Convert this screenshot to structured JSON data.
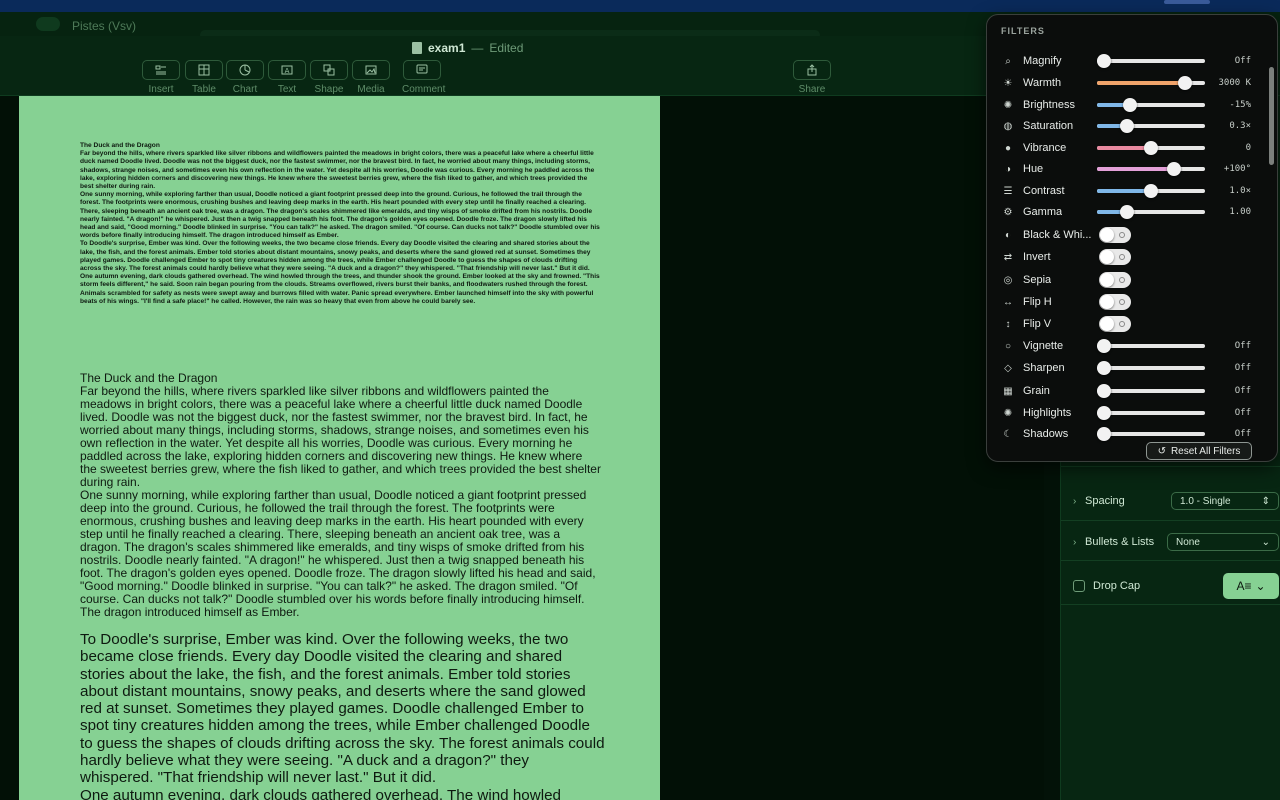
{
  "background_window": {
    "title": "Pistes (Vsv)"
  },
  "document": {
    "filename": "exam1",
    "status": "Edited"
  },
  "toolbar": {
    "insert": "Insert",
    "table": "Table",
    "chart": "Chart",
    "text": "Text",
    "shape": "Shape",
    "media": "Media",
    "comment": "Comment",
    "share": "Share"
  },
  "page": {
    "small_block": [
      "The Duck and the Dragon",
      "Far beyond the hills, where rivers sparkled like silver ribbons and wildflowers painted the meadows in bright colors, there was a peaceful lake where a cheerful little duck named Doodle lived. Doodle was not the biggest duck, nor the fastest swimmer, nor the bravest bird. In fact, he worried about many things, including storms, shadows, strange noises, and sometimes even his own reflection in the water. Yet despite all his worries, Doodle was curious. Every morning he paddled across the lake, exploring hidden corners and discovering new things. He knew where the sweetest berries grew, where the fish liked to gather, and which trees provided the best shelter during rain.",
      "One sunny morning, while exploring farther than usual, Doodle noticed a giant footprint pressed deep into the ground. Curious, he followed the trail through the forest. The footprints were enormous, crushing bushes and leaving deep marks in the earth. His heart pounded with every step until he finally reached a clearing. There, sleeping beneath an ancient oak tree, was a dragon. The dragon's scales shimmered like emeralds, and tiny wisps of smoke drifted from his nostrils. Doodle nearly fainted. \"A dragon!\" he whispered. Just then a twig snapped beneath his foot. The dragon's golden eyes opened. Doodle froze. The dragon slowly lifted his head and said, \"Good morning.\" Doodle blinked in surprise. \"You can talk?\" he asked. The dragon smiled. \"Of course. Can ducks not talk?\" Doodle stumbled over his words before finally introducing himself. The dragon introduced himself as Ember.",
      "To Doodle's surprise, Ember was kind. Over the following weeks, the two became close friends. Every day Doodle visited the clearing and shared stories about the lake, the fish, and the forest animals. Ember told stories about distant mountains, snowy peaks, and deserts where the sand glowed red at sunset. Sometimes they played games. Doodle challenged Ember to spot tiny creatures hidden among the trees, while Ember challenged Doodle to guess the shapes of clouds drifting across the sky. The forest animals could hardly believe what they were seeing. \"A duck and a dragon?\" they whispered. \"That friendship will never last.\" But it did.",
      "One autumn evening, dark clouds gathered overhead. The wind howled through the trees, and thunder shook the ground. Ember looked at the sky and frowned. \"This storm feels different,\" he said. Soon rain began pouring from the clouds. Streams overflowed, rivers burst their banks, and floodwaters rushed through the forest. Animals scrambled for safety as nests were swept away and burrows filled with water. Panic spread everywhere. Ember launched himself into the sky with powerful beats of his wings. \"I'll find a safe place!\" he called. However, the rain was so heavy that even from above he could barely see."
    ],
    "mid_block": [
      "The Duck and the Dragon",
      "Far beyond the hills, where rivers sparkled like silver ribbons and wildflowers painted the meadows in bright colors, there was a peaceful lake where a cheerful little duck named Doodle lived. Doodle was not the biggest duck, nor the fastest swimmer, nor the bravest bird. In fact, he worried about many things, including storms, shadows, strange noises, and sometimes even his own reflection in the water. Yet despite all his worries, Doodle was curious. Every morning he paddled across the lake, exploring hidden corners and discovering new things. He knew where the sweetest berries grew, where the fish liked to gather, and which trees provided the best shelter during rain.",
      "One sunny morning, while exploring farther than usual, Doodle noticed a giant footprint pressed deep into the ground. Curious, he followed the trail through the forest. The footprints were enormous, crushing bushes and leaving deep marks in the earth. His heart pounded with every step until he finally reached a clearing. There, sleeping beneath an ancient oak tree, was a dragon. The dragon's scales shimmered like emeralds, and tiny wisps of smoke drifted from his nostrils. Doodle nearly fainted. \"A dragon!\" he whispered. Just then a twig snapped beneath his foot. The dragon's golden eyes opened. Doodle froze. The dragon slowly lifted his head and said, \"Good morning.\" Doodle blinked in surprise. \"You can talk?\" he asked. The dragon smiled. \"Of course. Can ducks not talk?\" Doodle stumbled over his words before finally introducing himself. The dragon introduced himself as Ember."
    ],
    "big_block": [
      "To Doodle's surprise, Ember was kind. Over the following weeks, the two became close friends. Every day Doodle visited the clearing and shared stories about the lake, the fish, and the forest animals. Ember told stories about distant mountains, snowy peaks, and deserts where the sand glowed red at sunset. Sometimes they played games. Doodle challenged Ember to spot tiny creatures hidden among the trees, while Ember challenged Doodle to guess the shapes of clouds drifting across the sky. The forest animals could hardly believe what they were seeing. \"A duck and a dragon?\" they whispered. \"That friendship will never last.\" But it did.",
      "One autumn evening, dark clouds gathered overhead. The wind howled"
    ]
  },
  "filters": {
    "header": "FILTERS",
    "items": [
      {
        "name": "Magnify",
        "icon": "magnify-icon",
        "kind": "slider",
        "value": "Off",
        "level": 0.0,
        "fill": ""
      },
      {
        "name": "Warmth",
        "icon": "sun-icon",
        "kind": "slider",
        "value": "3000 K",
        "level": 0.86,
        "fill": "#f0a36a"
      },
      {
        "name": "Brightness",
        "icon": "brightness-icon",
        "kind": "slider",
        "value": "-15%",
        "level": 0.28,
        "fill": "#7fb7e8"
      },
      {
        "name": "Saturation",
        "icon": "palette-icon",
        "kind": "slider",
        "value": "0.3×",
        "level": 0.24,
        "fill": "#7fb7e8"
      },
      {
        "name": "Vibrance",
        "icon": "drop-icon",
        "kind": "slider",
        "value": "0",
        "level": 0.5,
        "fill": "#e98aa0"
      },
      {
        "name": "Hue",
        "icon": "hue-icon",
        "kind": "slider",
        "value": "+100°",
        "level": 0.74,
        "fill": "#e3a0d8"
      },
      {
        "name": "Contrast",
        "icon": "contrast-icon",
        "kind": "slider",
        "value": "1.0×",
        "level": 0.5,
        "fill": "#7fb7e8"
      },
      {
        "name": "Gamma",
        "icon": "gamma-icon",
        "kind": "slider",
        "value": "1.00",
        "level": 0.24,
        "fill": "#7fb7e8"
      },
      {
        "name": "Black & Whi...",
        "icon": "half-circle-icon",
        "kind": "toggle",
        "value": ""
      },
      {
        "name": "Invert",
        "icon": "invert-icon",
        "kind": "toggle",
        "value": ""
      },
      {
        "name": "Sepia",
        "icon": "sepia-icon",
        "kind": "toggle",
        "value": ""
      },
      {
        "name": "Flip H",
        "icon": "flip-h-icon",
        "kind": "toggle",
        "value": ""
      },
      {
        "name": "Flip V",
        "icon": "flip-v-icon",
        "kind": "toggle",
        "value": ""
      },
      {
        "name": "Vignette",
        "icon": "vignette-icon",
        "kind": "slider",
        "value": "Off",
        "level": 0.0,
        "fill": ""
      },
      {
        "name": "Sharpen",
        "icon": "sharpen-icon",
        "kind": "slider",
        "value": "Off",
        "level": 0.0,
        "fill": ""
      },
      {
        "name": "Grain",
        "icon": "grain-icon",
        "kind": "slider",
        "value": "Off",
        "level": 0.0,
        "fill": ""
      },
      {
        "name": "Highlights",
        "icon": "highlights-icon",
        "kind": "slider",
        "value": "Off",
        "level": 0.0,
        "fill": ""
      },
      {
        "name": "Shadows",
        "icon": "moon-icon",
        "kind": "slider",
        "value": "Off",
        "level": 0.0,
        "fill": ""
      }
    ],
    "reset_label": "Reset All Filters"
  },
  "inspector": {
    "spacing_label": "Spacing",
    "spacing_value": "1.0 - Single",
    "bullets_label": "Bullets & Lists",
    "bullets_value": "None",
    "dropcap_label": "Drop Cap"
  }
}
